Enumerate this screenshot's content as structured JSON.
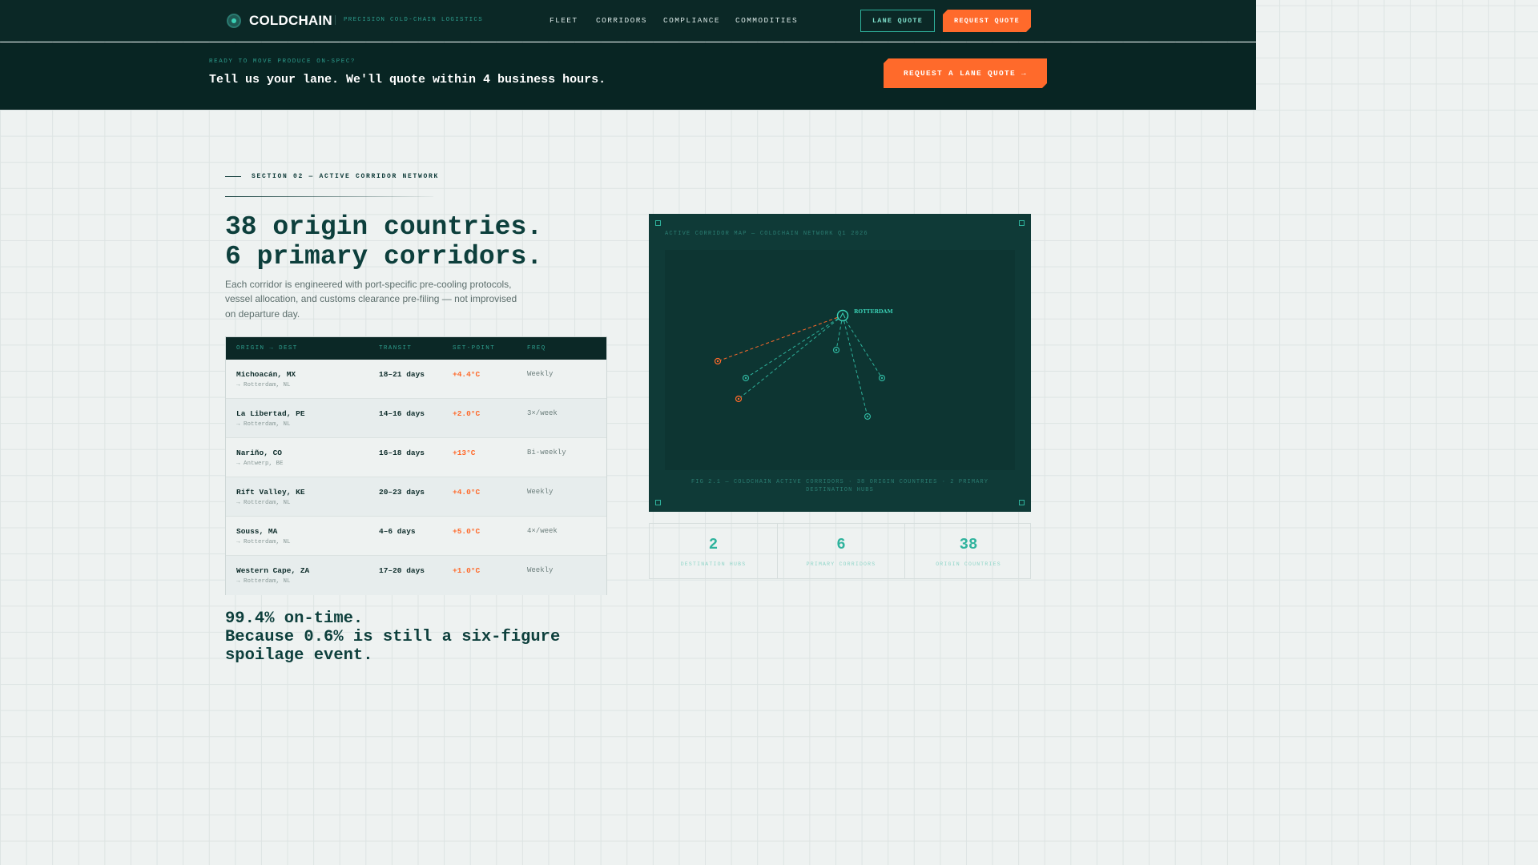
{
  "nav": {
    "brand": "COLDCHAIN",
    "tagline": "PRECISION COLD-CHAIN LOGISTICS",
    "links": [
      "FLEET",
      "CORRIDORS",
      "COMPLIANCE",
      "COMMODITIES"
    ],
    "lane_quote": "LANE QUOTE",
    "request_quote": "REQUEST QUOTE"
  },
  "cta": {
    "eyebrow": "READY TO MOVE PRODUCE ON-SPEC?",
    "headline": "Tell us your lane. We'll quote within 4 business hours.",
    "button": "REQUEST A LANE QUOTE →"
  },
  "section": {
    "label": "SECTION 02 — ACTIVE CORRIDOR NETWORK",
    "headline_1": "38 origin countries.",
    "headline_2": "6 primary corridors.",
    "lede": "Each corridor is engineered with port-specific pre-cooling protocols, vessel allocation, and customs clearance pre-filing — not improvised on departure day."
  },
  "table": {
    "headers": [
      "ORIGIN → DEST",
      "TRANSIT",
      "SET-POINT",
      "FREQ"
    ],
    "rows": [
      {
        "origin": "Michoacán, MX",
        "dest": "→ Rotterdam, NL",
        "transit": "18–21 days",
        "setpoint": "+4.4°C",
        "freq": "Weekly"
      },
      {
        "origin": "La Libertad, PE",
        "dest": "→ Rotterdam, NL",
        "transit": "14–16 days",
        "setpoint": "+2.0°C",
        "freq": "3×/week"
      },
      {
        "origin": "Nariño, CO",
        "dest": "→ Antwerp, BE",
        "transit": "16–18 days",
        "setpoint": "+13°C",
        "freq": "Bi-weekly"
      },
      {
        "origin": "Rift Valley, KE",
        "dest": "→ Rotterdam, NL",
        "transit": "20–23 days",
        "setpoint": "+4.0°C",
        "freq": "Weekly"
      },
      {
        "origin": "Souss, MA",
        "dest": "→ Rotterdam, NL",
        "transit": "4–6 days",
        "setpoint": "+5.0°C",
        "freq": "4×/week"
      },
      {
        "origin": "Western Cape, ZA",
        "dest": "→ Rotterdam, NL",
        "transit": "17–20 days",
        "setpoint": "+1.0°C",
        "freq": "Weekly"
      }
    ]
  },
  "ontime": {
    "line_1": "99.4% on-time.",
    "line_2": "Because 0.6% is still a six-figure spoilage event."
  },
  "map": {
    "title": "ACTIVE CORRIDOR MAP — COLDCHAIN NETWORK Q1 2026",
    "hub_label": "ROTTERDAM",
    "caption": "FIG 2.1 — COLDCHAIN ACTIVE CORRIDORS · 38 ORIGIN COUNTRIES · 2 PRIMARY DESTINATION HUBS",
    "accent_color": "#2fb39d",
    "highlight_color": "#ff6a2b"
  },
  "stats": [
    {
      "value": "2",
      "label": "DESTINATION HUBS"
    },
    {
      "value": "6",
      "label": "PRIMARY CORRIDORS"
    },
    {
      "value": "38",
      "label": "ORIGIN COUNTRIES"
    }
  ]
}
